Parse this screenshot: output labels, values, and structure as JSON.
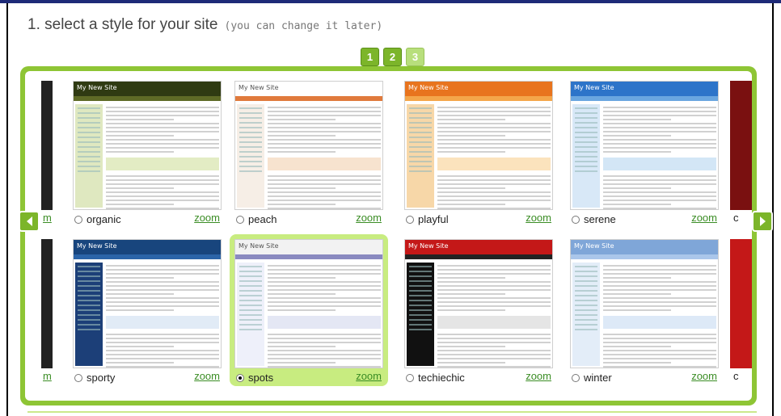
{
  "heading": {
    "title": "1. select a style for your site",
    "subtitle": "(you can change it later)"
  },
  "pager": {
    "pages": [
      "1",
      "2",
      "3"
    ],
    "current": "3"
  },
  "thumb_site_title": "My New Site",
  "zoom_label": "zoom",
  "partial_left_labels": [
    "m",
    "m"
  ],
  "partial_right_labels": [
    "c",
    "c"
  ],
  "styles": [
    {
      "name": "organic",
      "selected": false,
      "header": "#2f3a12",
      "nav": "#5e6a26",
      "side": "#dfe8c0",
      "accent": "#c8d98a"
    },
    {
      "name": "peach",
      "selected": false,
      "header": "#ffffff",
      "nav": "#e07a3c",
      "side": "#f6eee6",
      "accent": "#f0c8a0"
    },
    {
      "name": "playful",
      "selected": false,
      "header": "#e8741e",
      "nav": "#f4a64a",
      "side": "#f7d7a8",
      "accent": "#f7c77c"
    },
    {
      "name": "serene",
      "selected": false,
      "header": "#2d74c9",
      "nav": "#6aa6e0",
      "side": "#d8e8f7",
      "accent": "#a8cdee"
    },
    {
      "name": "sporty",
      "selected": false,
      "header": "#18457d",
      "nav": "#2b64a8",
      "side": "#1c3f78",
      "accent": "#c4d7ee"
    },
    {
      "name": "spots",
      "selected": true,
      "header": "#f2f2f2",
      "nav": "#8a8ac0",
      "side": "#eef0fa",
      "accent": "#c9d0ea"
    },
    {
      "name": "techiechic",
      "selected": false,
      "header": "#c41818",
      "nav": "#222222",
      "side": "#111111",
      "accent": "#cccccc"
    },
    {
      "name": "winter",
      "selected": false,
      "header": "#7fa6d8",
      "nav": "#aac6ea",
      "side": "#e3edf8",
      "accent": "#bcd4ef"
    }
  ]
}
